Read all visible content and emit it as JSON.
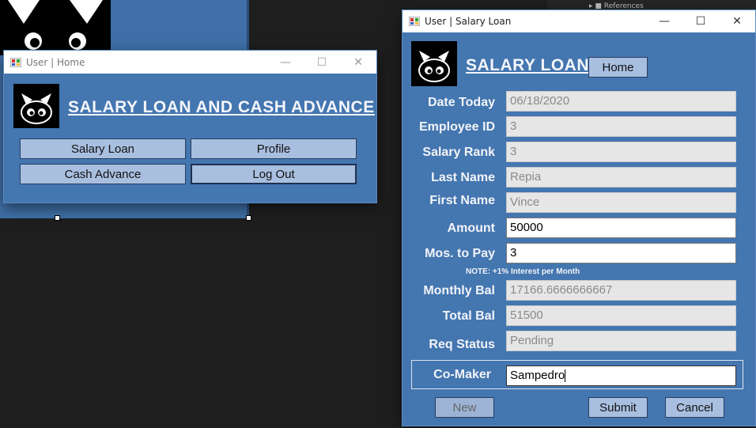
{
  "home_window": {
    "title": "User | Home",
    "heading": "SALARY LOAN AND CASH ADVANCE",
    "buttons": {
      "salary_loan": "Salary Loan",
      "profile": "Profile",
      "cash_advance": "Cash Advance",
      "log_out": "Log Out"
    }
  },
  "loan_window": {
    "title": "User | Salary Loan",
    "heading": "SALARY LOAN",
    "home_button": "Home",
    "fields": {
      "date_today": {
        "label": "Date Today",
        "value": "06/18/2020"
      },
      "employee_id": {
        "label": "Employee ID",
        "value": "3"
      },
      "salary_rank": {
        "label": "Salary Rank",
        "value": "3"
      },
      "last_name": {
        "label": "Last Name",
        "value": "Repia"
      },
      "first_name": {
        "label": "First Name",
        "value": "Vince"
      },
      "amount": {
        "label": "Amount",
        "value": "50000"
      },
      "mos_to_pay": {
        "label": "Mos. to Pay",
        "value": "3"
      },
      "monthly_bal": {
        "label": "Monthly Bal",
        "value": "17166.6666666667"
      },
      "total_bal": {
        "label": "Total Bal",
        "value": "51500"
      },
      "req_status": {
        "label": "Req Status",
        "value": "Pending"
      },
      "co_maker": {
        "label": "Co-Maker",
        "value": "Sampedro"
      }
    },
    "note": "NOTE: +1% Interest per Month",
    "buttons": {
      "new": "New",
      "submit": "Submit",
      "cancel": "Cancel"
    }
  },
  "background": {
    "tree_text": "▸ ■ References"
  },
  "window_controls": {
    "minimize": "—",
    "maximize": "☐",
    "close": "✕"
  }
}
